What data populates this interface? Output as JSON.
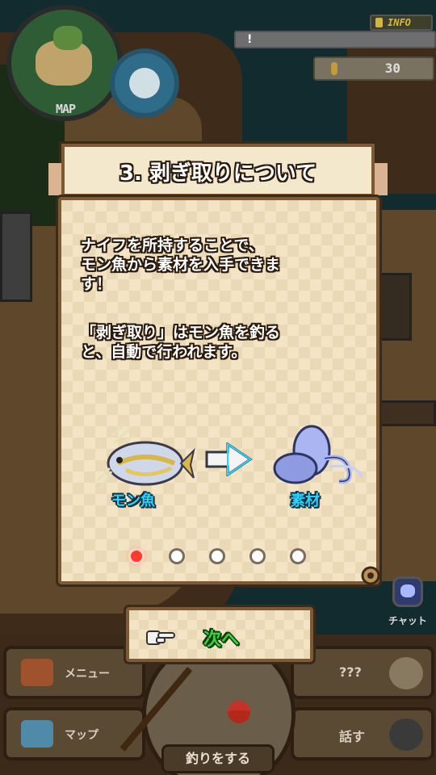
{
  "hud": {
    "map_label": "MAP",
    "info_label": "INFO",
    "notice_text": "!",
    "coin_count": "30"
  },
  "tutorial": {
    "title": "3. 剥ぎ取りについて",
    "paragraph1": "ナイフを所持することで、\nモン魚から素材を入手できま\nす！",
    "paragraph2": "「剥ぎ取り」はモン魚を釣る\nと、自動で行われます。",
    "fish_label": "モン魚",
    "material_label": "素材",
    "page_index": 1,
    "page_count": 5,
    "next_label": "次へ"
  },
  "bottom_menu": {
    "menu_label": "メニュー",
    "map_label": "マップ",
    "unknown_label": "???",
    "talk_label": "話す",
    "fish_button_label": "釣りをする",
    "chat_label": "チャット"
  },
  "colors": {
    "panel_bg": "#ead9b6",
    "panel_border": "#7c5a36",
    "label_cyan": "#2bd3ff",
    "next_green": "#37d23a",
    "active_dot": "#ff3b2d"
  },
  "icons": [
    "hand-pointer-icon",
    "fish-icon",
    "material-icon",
    "arrow-right-icon",
    "treasure-chest-icon",
    "map-icon",
    "gear-icon",
    "chat-icon",
    "info-icon",
    "coin-icon"
  ]
}
